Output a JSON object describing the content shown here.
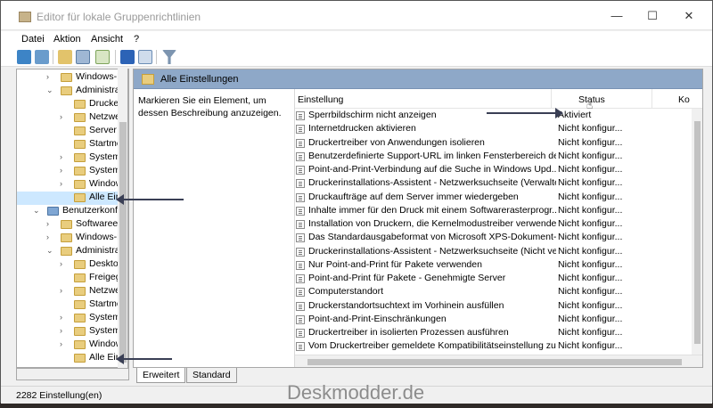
{
  "window": {
    "title": "Editor für lokale Gruppenrichtlinien",
    "minimize": "—",
    "maximize": "☐",
    "close": "✕"
  },
  "menu": [
    "Datei",
    "Aktion",
    "Ansicht",
    "?"
  ],
  "tree": [
    {
      "label": "Windows-Eins",
      "indent": 1,
      "arrow": "›"
    },
    {
      "label": "Administrative",
      "indent": 1,
      "arrow": "⌄"
    },
    {
      "label": "Drucker",
      "indent": 2,
      "arrow": ""
    },
    {
      "label": "Netzwerk",
      "indent": 2,
      "arrow": "›"
    },
    {
      "label": "Server",
      "indent": 2,
      "arrow": ""
    },
    {
      "label": "Startmenü",
      "indent": 2,
      "arrow": ""
    },
    {
      "label": "System",
      "indent": 2,
      "arrow": "›"
    },
    {
      "label": "Systemste",
      "indent": 2,
      "arrow": "›"
    },
    {
      "label": "Windows-",
      "indent": 2,
      "arrow": "›"
    },
    {
      "label": "Alle Einste",
      "indent": 2,
      "arrow": "",
      "selected": true
    },
    {
      "label": "Benutzerkonfigur",
      "indent": 0,
      "arrow": "⌄",
      "user": true
    },
    {
      "label": "Softwareeinste",
      "indent": 1,
      "arrow": "›"
    },
    {
      "label": "Windows-Eins",
      "indent": 1,
      "arrow": "›"
    },
    {
      "label": "Administrative",
      "indent": 1,
      "arrow": "⌄"
    },
    {
      "label": "Desktop",
      "indent": 2,
      "arrow": "›"
    },
    {
      "label": "Freigegeb",
      "indent": 2,
      "arrow": ""
    },
    {
      "label": "Netzwerk",
      "indent": 2,
      "arrow": "›"
    },
    {
      "label": "Startmenü",
      "indent": 2,
      "arrow": ""
    },
    {
      "label": "System",
      "indent": 2,
      "arrow": "›"
    },
    {
      "label": "Systemste",
      "indent": 2,
      "arrow": "›"
    },
    {
      "label": "Windows-",
      "indent": 2,
      "arrow": "›"
    },
    {
      "label": "Alle Einste",
      "indent": 2,
      "arrow": ""
    }
  ],
  "pane": {
    "title": "Alle Einstellungen",
    "description": "Markieren Sie ein Element, um dessen Beschreibung anzuzeigen.",
    "col_setting": "Einstellung",
    "col_status": "Status",
    "col_comment": "Ko"
  },
  "rows": [
    {
      "name": "Sperrbildschirm nicht anzeigen",
      "status": "Aktiviert"
    },
    {
      "name": "Internetdrucken aktivieren",
      "status": "Nicht konfigur..."
    },
    {
      "name": "Druckertreiber von Anwendungen isolieren",
      "status": "Nicht konfigur..."
    },
    {
      "name": "Benutzerdefinierte Support-URL im linken Fensterbereich de...",
      "status": "Nicht konfigur..."
    },
    {
      "name": "Point-and-Print-Verbindung auf die Suche in Windows Upd...",
      "status": "Nicht konfigur..."
    },
    {
      "name": "Druckerinstallations-Assistent - Netzwerksuchseite (Verwalte...",
      "status": "Nicht konfigur..."
    },
    {
      "name": "Druckaufträge auf dem Server immer wiedergeben",
      "status": "Nicht konfigur..."
    },
    {
      "name": "Inhalte immer für den Druck mit einem Softwarerasterprogr...",
      "status": "Nicht konfigur..."
    },
    {
      "name": "Installation von Druckern, die Kernelmodustreiber verwende...",
      "status": "Nicht konfigur..."
    },
    {
      "name": "Das Standardausgabeformat von Microsoft XPS-Dokument-...",
      "status": "Nicht konfigur..."
    },
    {
      "name": "Druckerinstallations-Assistent - Netzwerksuchseite (Nicht ve...",
      "status": "Nicht konfigur..."
    },
    {
      "name": "Nur Point-and-Print für Pakete verwenden",
      "status": "Nicht konfigur..."
    },
    {
      "name": "Point-and-Print für Pakete - Genehmigte Server",
      "status": "Nicht konfigur..."
    },
    {
      "name": "Computerstandort",
      "status": "Nicht konfigur..."
    },
    {
      "name": "Druckerstandortsuchtext im Vorhinein ausfüllen",
      "status": "Nicht konfigur..."
    },
    {
      "name": "Point-and-Print-Einschränkungen",
      "status": "Nicht konfigur..."
    },
    {
      "name": "Druckertreiber in isolierten Prozessen ausführen",
      "status": "Nicht konfigur..."
    },
    {
      "name": "Vom Druckertreiber gemeldete Kompatibilitätseinstellung zu...",
      "status": "Nicht konfigur..."
    }
  ],
  "tabs": [
    "Erweitert",
    "Standard"
  ],
  "status": "2282 Einstellung(en)",
  "watermark": "Deskmodder.de"
}
